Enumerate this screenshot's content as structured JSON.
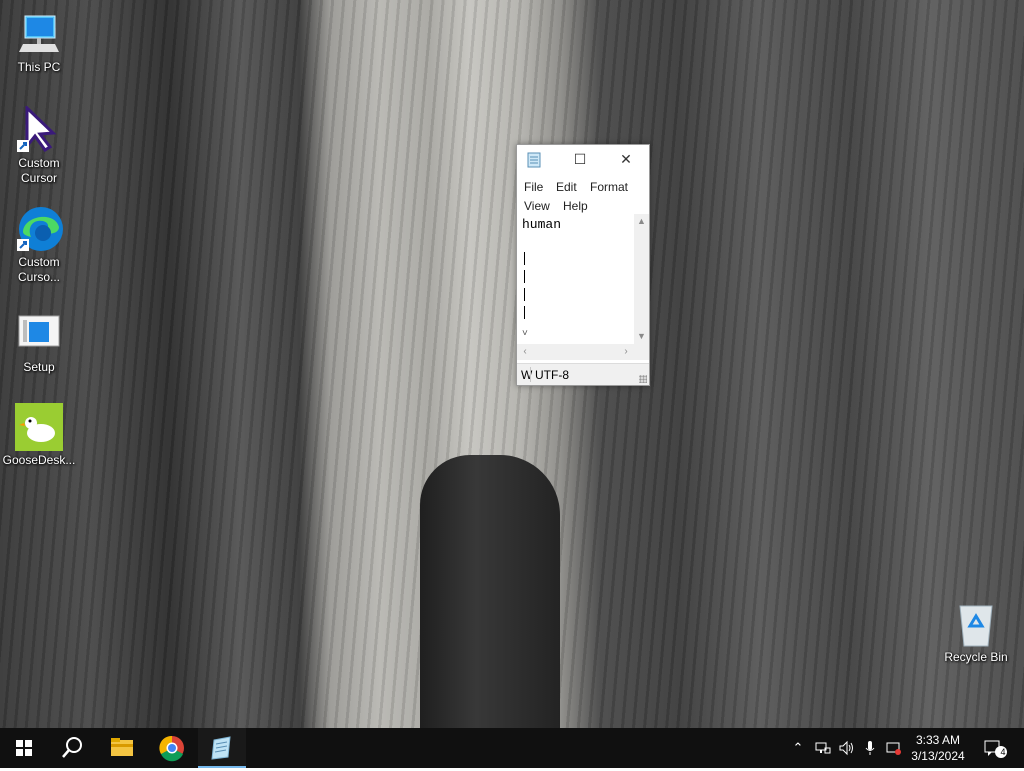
{
  "desktop": {
    "icons": [
      {
        "label": "This PC"
      },
      {
        "label": "Custom Cursor"
      },
      {
        "label": "Custom Curso..."
      },
      {
        "label": "Setup"
      },
      {
        "label": "GooseDesk..."
      }
    ],
    "recycle_bin": {
      "label": "Recycle Bin"
    }
  },
  "notepad": {
    "menu": [
      "File",
      "Edit",
      "Format",
      "View",
      "Help"
    ],
    "text_first_line": "human",
    "status": {
      "segment1": "W",
      "encoding": "UTF-8"
    }
  },
  "taskbar": {
    "pinned": [
      "start-icon",
      "search-icon",
      "file-explorer-icon",
      "chrome-icon",
      "notepad-icon"
    ],
    "time": "3:33 AM",
    "date": "3/13/2024",
    "notification_count": "4"
  },
  "colors": {
    "taskbar_bg": "#101010",
    "active_indicator": "#76b9ed",
    "edge_blue": "#0f7fd6",
    "goose_green": "#9acd32"
  }
}
